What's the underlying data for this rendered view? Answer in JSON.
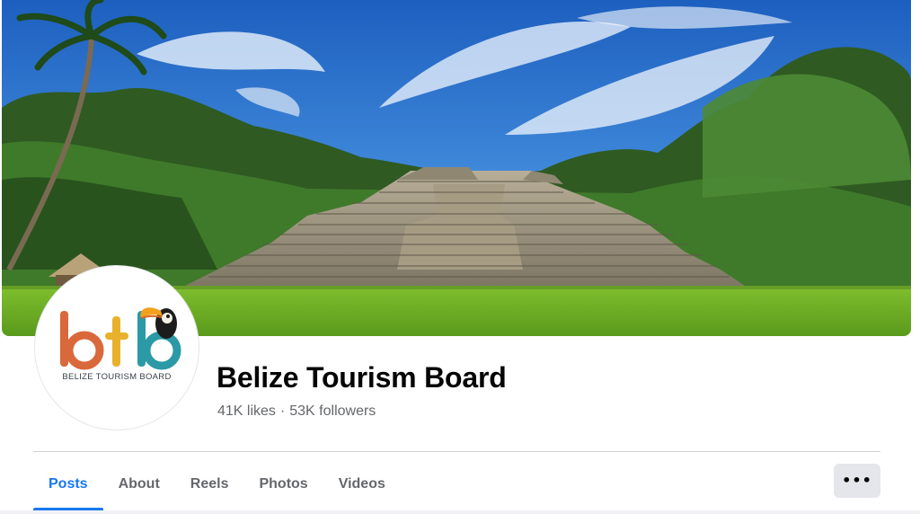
{
  "cover": {
    "image": "Mayan pyramid ruin in jungle under blue sky"
  },
  "profile": {
    "logo_text": "btb",
    "logo_caption": "BELIZE TOURISM BOARD",
    "name": "Belize Tourism Board",
    "likes": "41K likes",
    "separator": "·",
    "followers": "53K followers"
  },
  "tabs": [
    {
      "label": "Posts",
      "active": true
    },
    {
      "label": "About",
      "active": false
    },
    {
      "label": "Reels",
      "active": false
    },
    {
      "label": "Photos",
      "active": false
    },
    {
      "label": "Videos",
      "active": false
    }
  ],
  "more_button": {
    "icon": "more-horizontal-icon",
    "glyph": "•••"
  },
  "colors": {
    "accent": "#1877f2",
    "logo_b1": "#d9683a",
    "logo_t": "#e8b12c",
    "logo_b2": "#2b9aa6"
  }
}
